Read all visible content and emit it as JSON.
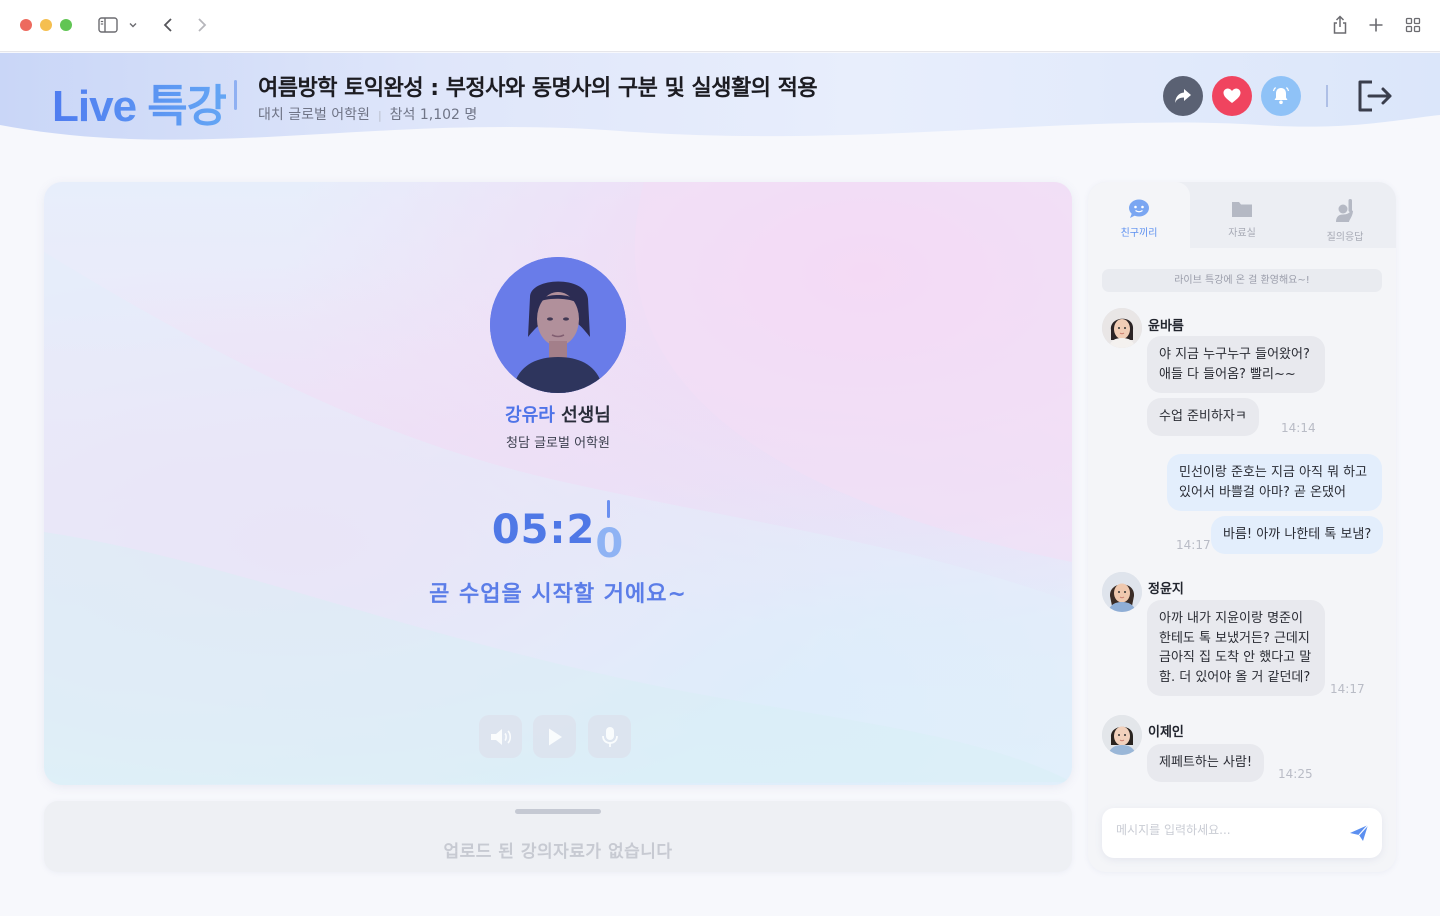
{
  "header": {
    "brand": "Live 특강",
    "title": "여름방학 토익완성 : 부정사와 동명사의 구분 및 실생활의 적용",
    "academy": "대치 글로벌 어학원",
    "attendance": "참석 1,102 명"
  },
  "teacher": {
    "name_highlight": "강유라",
    "name_suffix": " 선생님",
    "school": "청담 글로벌 어학원"
  },
  "timer": {
    "main": "05:2",
    "last_digit": "0"
  },
  "status_message": "곧 수업을 시작할 거에요~",
  "materials": {
    "empty_text": "업로드 된 강의자료가 없습니다"
  },
  "chat": {
    "tabs": [
      {
        "label": "친구끼리",
        "icon": "chat-bubble-icon"
      },
      {
        "label": "자료실",
        "icon": "folder-icon"
      },
      {
        "label": "질의응답",
        "icon": "raise-hand-icon"
      }
    ],
    "welcome": "라이브 특강에 온 걸 환영해요~!",
    "messages": {
      "m1": {
        "name": "윤바름",
        "line1": "야 지금 누구누구 들어왔어?",
        "line2": "애들 다 들어옴? 빨리~~"
      },
      "m2": {
        "text": "수업 준비하자ㅋ",
        "time": "14:14"
      },
      "m3": {
        "line1": "민선이랑 준호는 지금 아직 뭐 하고",
        "line2": "있어서 바쁠걸 아마? 곧 온댔어"
      },
      "m4": {
        "text": "바름! 아까 나한테 톡 보냄?",
        "time": "14:17"
      },
      "m5": {
        "name": "정윤지",
        "line1": "아까 내가 지윤이랑 명준이",
        "line2": "한테도 톡 보냈거든? 근데지",
        "line3": "금아직 집 도착 안 했다고 말",
        "line4": "함. 더 있어야 올 거 같던데?",
        "time": "14:17"
      },
      "m6": {
        "name": "이제인",
        "text": "제페트하는 사람!",
        "time": "14:25"
      }
    },
    "input_placeholder": "메시지를 입력하세요..."
  },
  "colors": {
    "accent": "#4f78e6",
    "heart": "#f0445f",
    "bell": "#8fc2f7",
    "share": "#5a6173"
  }
}
